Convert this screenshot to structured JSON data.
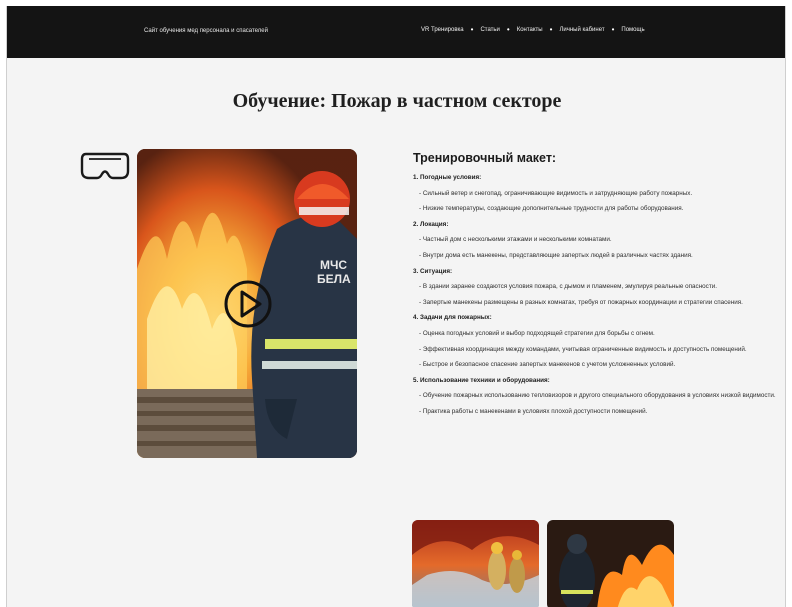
{
  "header": {
    "site_name": "Сайт обучения мед персонала и спасателей",
    "nav": [
      {
        "label": "VR Тренировка"
      },
      {
        "label": "Статьи"
      },
      {
        "label": "Контакты"
      },
      {
        "label": "Личный кабинет"
      },
      {
        "label": "Помощь"
      }
    ],
    "separator": "•"
  },
  "page": {
    "title": "Обучение: Пожар в частном секторе"
  },
  "info": {
    "heading": "Тренировочный макет:",
    "sections": [
      {
        "title": "1. Погодные условия:",
        "items": [
          "- Сильный ветер и снегопад, ограничивающие видимость и затрудняющие работу пожарных.",
          "- Низкие температуры, создающие дополнительные трудности для работы оборудования."
        ]
      },
      {
        "title": "2. Локация:",
        "items": [
          "- Частный дом с несколькими этажами и несколькими комнатами.",
          "- Внутри дома есть манекены, представляющие запертых людей в различных частях здания."
        ]
      },
      {
        "title": "3. Ситуация:",
        "items": [
          "- В здании заранее создаются условия пожара, с дымом и пламенем, эмулируя реальные опасности.",
          "- Запертые манекены размещены в разных комнатах, требуя от пожарных координации и стратегии спасения."
        ]
      },
      {
        "title": "4. Задачи для пожарных:",
        "items": [
          "- Оценка погодных условий и выбор подходящей стратегии для борьбы с огнем.",
          "- Эффективная координация между командами, учитывая ограниченные видимость и доступность помещений.",
          "- Быстрое и безопасное спасение запертых манекенов с учетом усложненных условий."
        ]
      },
      {
        "title": "5. Использование техники и оборудования:",
        "items": [
          "- Обучение пожарных использованию тепловизоров и другого специального оборудования в условиях низкой видимости.",
          "- Практика работы с манекенами в условиях плохой доступности помещений."
        ]
      }
    ]
  },
  "video": {
    "uniform_text": "МЧС\nБЕЛА"
  },
  "icons": {
    "vr": "vr-headset-icon",
    "play": "play-icon"
  },
  "colors": {
    "header_bg": "#141414",
    "page_bg": "#f4f4f4",
    "accent_fire": "#ff8a1e"
  }
}
